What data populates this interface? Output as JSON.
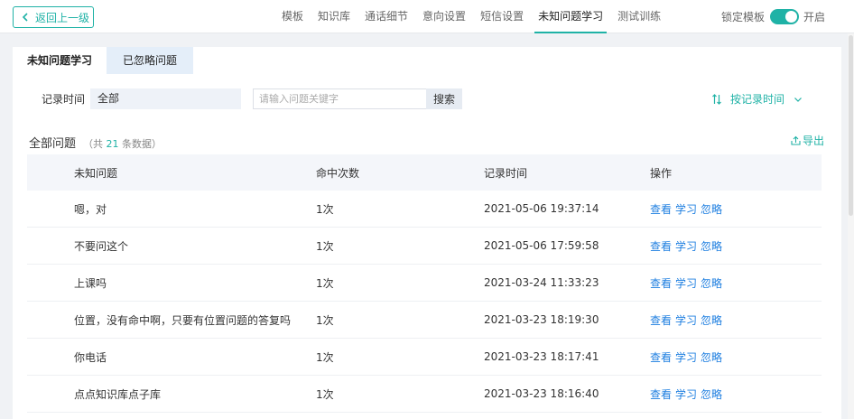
{
  "header": {
    "back_label": "返回上一级",
    "nav": [
      "模板",
      "知识库",
      "通话细节",
      "意向设置",
      "短信设置",
      "未知问题学习",
      "测试训练"
    ],
    "active_nav": 5,
    "lock_label": "锁定模板",
    "toggle_label": "开启"
  },
  "tabs": [
    "未知问题学习",
    "已忽略问题"
  ],
  "filter": {
    "time_label": "记录时间",
    "time_value": "全部",
    "search_placeholder": "请输入问题关键字",
    "search_button": "搜索",
    "sort_label": "按记录时间"
  },
  "list": {
    "title": "全部问题",
    "count_prefix": "（共",
    "count": "21",
    "count_suffix": "条数据）",
    "export_label": "导出"
  },
  "table": {
    "headers": [
      "未知问题",
      "命中次数",
      "记录时间",
      "操作"
    ],
    "rows": [
      {
        "question": "嗯，对",
        "hits": "1次",
        "time": "2021-05-06 19:37:14"
      },
      {
        "question": "不要问这个",
        "hits": "1次",
        "time": "2021-05-06 17:59:58"
      },
      {
        "question": "上课吗",
        "hits": "1次",
        "time": "2021-03-24 11:33:23"
      },
      {
        "question": "位置，没有命中啊，只要有位置问题的答复吗",
        "hits": "1次",
        "time": "2021-03-23 18:19:30"
      },
      {
        "question": "你电话",
        "hits": "1次",
        "time": "2021-03-23 18:17:41"
      },
      {
        "question": "点点知识库点子库",
        "hits": "1次",
        "time": "2021-03-23 18:16:40"
      }
    ],
    "actions": [
      "查看",
      "学习",
      "忽略"
    ]
  },
  "colors": {
    "accent": "#1fb2a6",
    "link": "#1f7fe0"
  }
}
